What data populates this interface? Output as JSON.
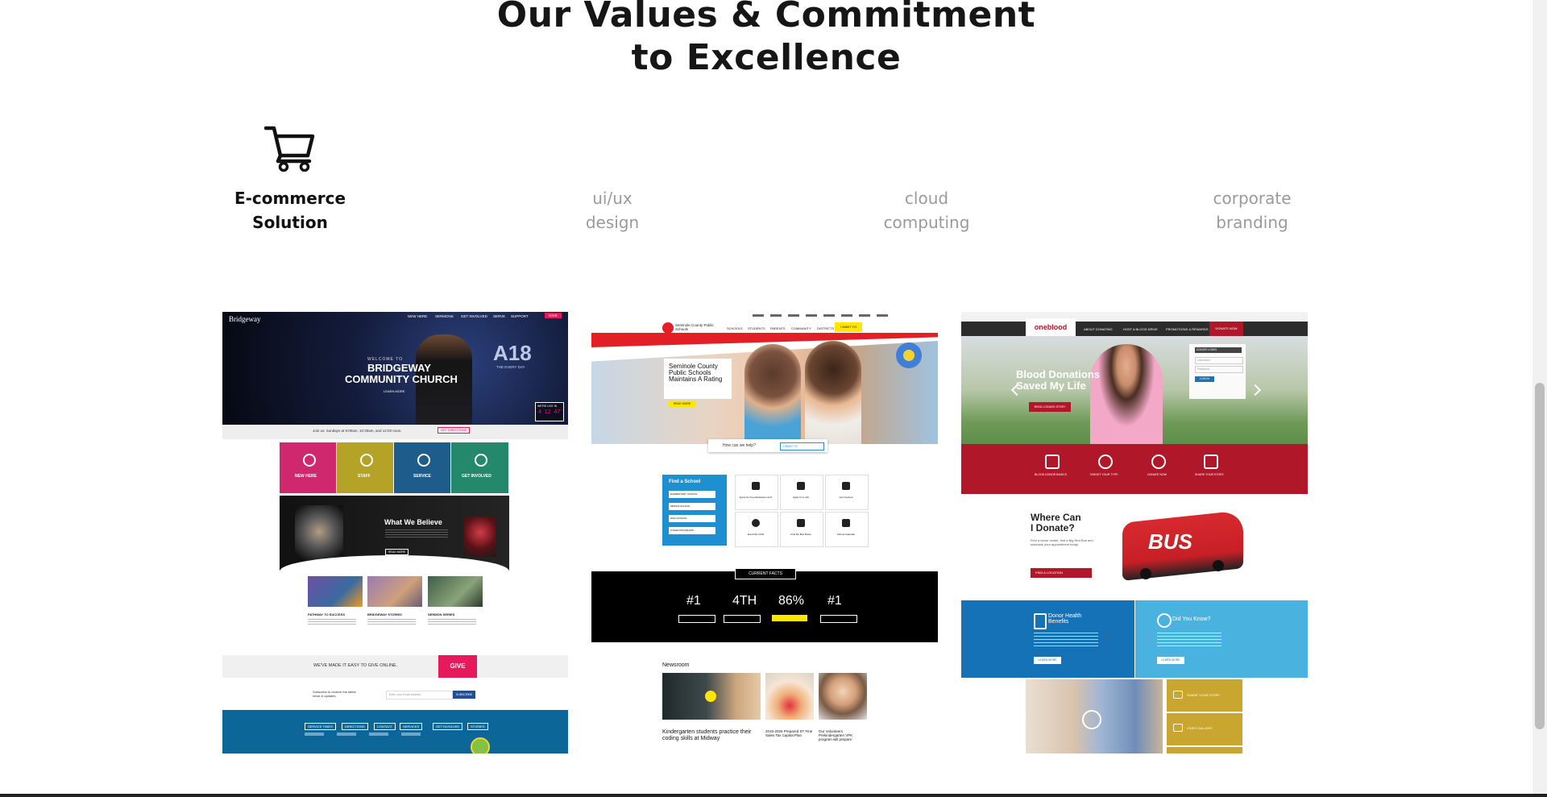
{
  "section": {
    "title_line1": "Our Values & Commitment",
    "title_line2": "to Excellence"
  },
  "tabs": [
    {
      "line1": "E-commerce",
      "line2": "Solution",
      "active": true,
      "icon": "shopping-cart-icon"
    },
    {
      "line1": "ui/ux",
      "line2": "design",
      "active": false
    },
    {
      "line1": "cloud",
      "line2": "computing",
      "active": false
    },
    {
      "line1": "corporate",
      "line2": "branding",
      "active": false
    }
  ],
  "portfolio": {
    "bridgeway": {
      "logo": "Bridgeway",
      "nav": [
        "NEW HERE",
        "SERMONS",
        "GET INVOLVED",
        "SERVE",
        "SUPPORT"
      ],
      "give": "GIVE",
      "welcome": "WELCOME TO",
      "name_line1": "BRIDGEWAY",
      "name_line2": "COMMUNITY CHURCH",
      "learn_more": "LEARN MORE",
      "big_text": "A18",
      "sub_big": "THE EVERY DAY",
      "countdown_label": "WE'RE LIVE IN",
      "countdown": "4  12  47",
      "join_text": "Join us: Sundays at 9:00am, 10:30am, and 12:00 noon.",
      "join_btn": "GET DIRECTIONS",
      "tiles": [
        "NEW HERE",
        "STAFF",
        "SERVICE",
        "GET INVOLVED"
      ],
      "believe_title": "What We Believe",
      "believe_btn": "READ MORE",
      "cards": [
        "PATHWAY TO SUCCESS",
        "BRIDGEWAY STORIES",
        "SERMON SERIES"
      ],
      "online_text": "WE'VE MADE IT EASY TO GIVE ONLINE.",
      "give_btn": "GIVE",
      "subscribe_text": "Subscribe to receive the latest news & updates.",
      "subscribe_placeholder": "Enter your Email address",
      "subscribe_btn": "SUBSCRIBE",
      "footer_links": [
        "SERVICE TIMES",
        "DIRECTIONS",
        "CONTACT",
        "SERVICES",
        "GET INVOLVED",
        "STORIES"
      ]
    },
    "seminole": {
      "org": "Seminole County Public Schools",
      "nav": [
        "SCHOOLS",
        "STUDENTS",
        "PARENTS",
        "COMMUNITY",
        "DISTRICTS"
      ],
      "nav_cta": "I WANT TO",
      "headline": "Seminole County Public Schools Maintains A Rating",
      "read_more": "READ MORE",
      "help_text": "How can we help?",
      "help_select": "I WANT TO",
      "find_school": "Find a School",
      "find_options": [
        "ELEMENTARY SCHOOL",
        "MIDDLE SCHOOL",
        "HIGH SCHOOL",
        "OTHER PROGRAMS"
      ],
      "quick_links": [
        "Apply for Free Reduced Lunch",
        "Apply for a Job",
        "Get Involved",
        "Enroll My Child",
        "Find My Bus Route",
        "School Calendar"
      ],
      "facts_title": "CURRENT FACTS",
      "facts": [
        "#1",
        "4TH",
        "86%",
        "#1"
      ],
      "newsroom": "Newsroom",
      "news": [
        "Kindergarten students practice their coding skills at Midway",
        "2015-2025 Prepared ST Fine Sales Tax Capital Plan",
        "Our Volunteers Prekindergarten VPK program will prepare"
      ]
    },
    "oneblood": {
      "logo": "oneblood",
      "nav": [
        "ABOUT DONATING",
        "HOST A BLOOD DRIVE",
        "PROMOTIONS & REWARDS"
      ],
      "nav_cta": "DONATE NOW",
      "hero_line1": "Blood Donations",
      "hero_line2": "Saved My Life",
      "hero_btn": "READ LOGAN'S STORY",
      "login_title": "DONOR LOGIN",
      "login_user": "Username",
      "login_pass": "Password",
      "login_btn": "LOG IN",
      "quick": [
        "BLOOD DONOR BASICS",
        "TARGET YOUR TYPE",
        "DONATE NOW",
        "SHARE YOUR STORY"
      ],
      "where_line1": "Where Can",
      "where_line2": "I Donate?",
      "where_text": "Find a donor center, find a Big Red Bus and schedule your appointment today.",
      "where_btn": "FIND A LOCATION",
      "bus_text": "BUS",
      "health_title": "Donor Health Benefits",
      "health_btn": "LEARN MORE",
      "know_title": "Did You Know?",
      "know_btn": "LEARN MORE",
      "share": "SHARE YOUR STORY",
      "video": "VIDEO GALLERY"
    }
  },
  "colors": {
    "accent_magenta": "#e6195d",
    "seminole_red": "#e21f26",
    "oneblood_red": "#b0182a",
    "teal_blue": "#0b6fa4",
    "gold": "#c9a630"
  }
}
